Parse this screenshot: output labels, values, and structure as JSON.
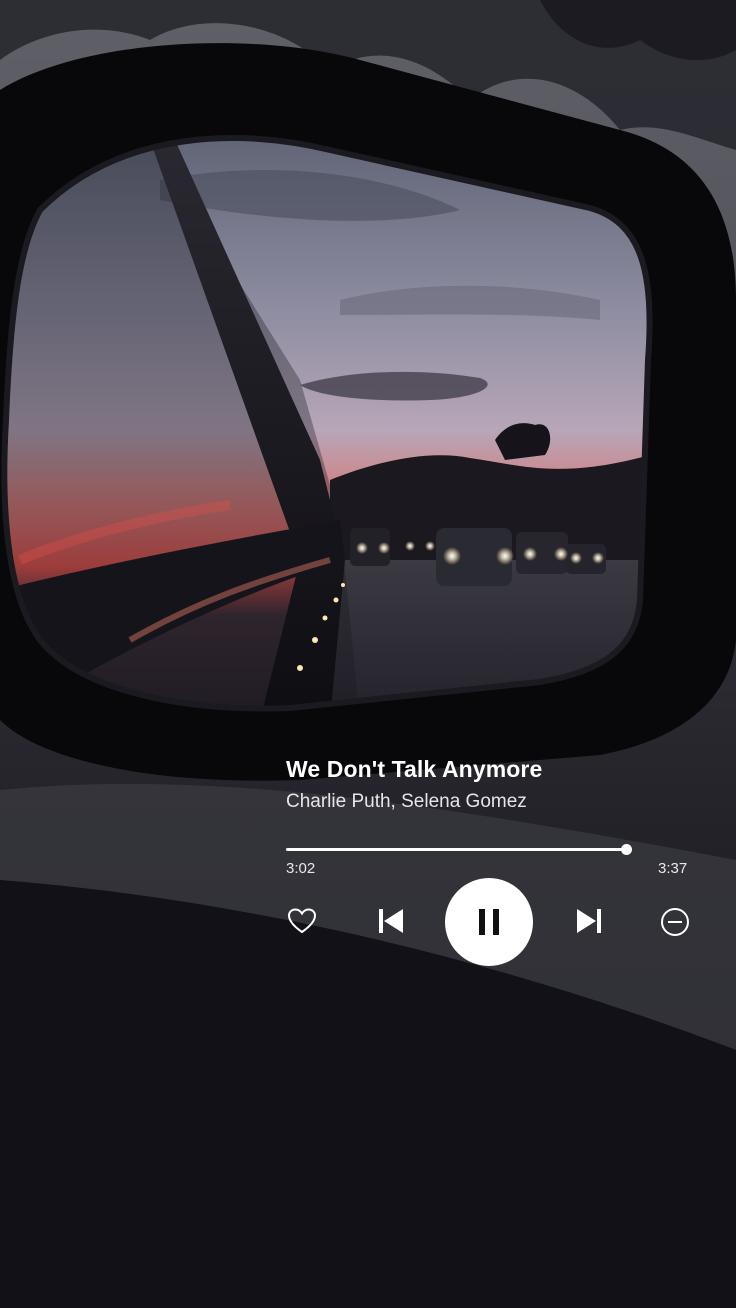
{
  "player": {
    "track_title": "We Don't Talk Anymore",
    "artists": "Charlie Puth, Selena Gomez",
    "elapsed": "3:02",
    "duration": "3:37",
    "progress_fraction": 0.993,
    "state": "playing"
  },
  "controls": {
    "like_icon": "heart-outline-icon",
    "previous_icon": "skip-previous-icon",
    "pause_icon": "pause-icon",
    "next_icon": "skip-next-icon",
    "hide_icon": "minus-circle-icon"
  },
  "colors": {
    "text": "#ffffff",
    "button_bg": "#ffffff",
    "button_icon": "#111111",
    "sunset": "#e3504a"
  }
}
